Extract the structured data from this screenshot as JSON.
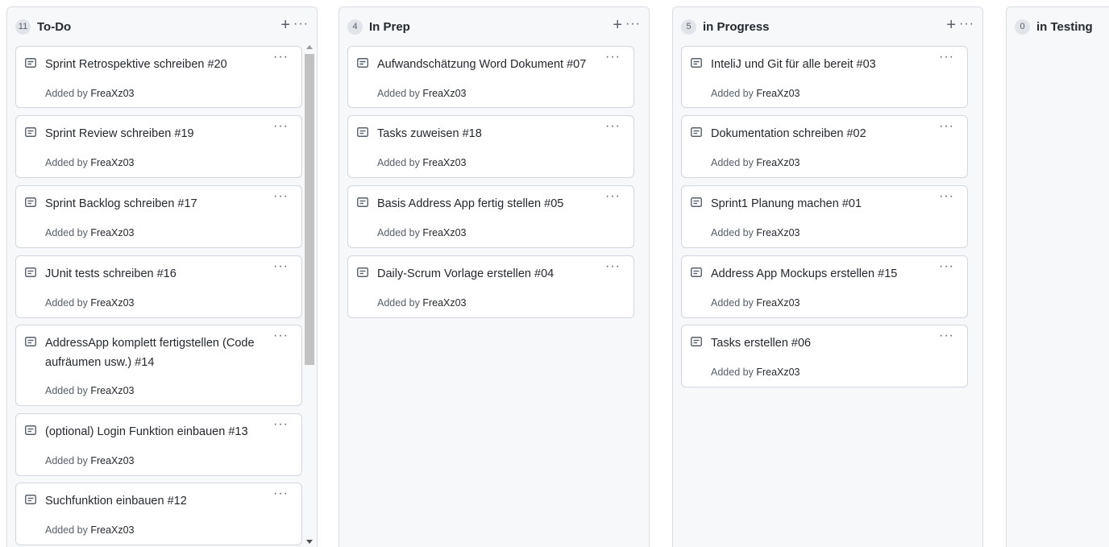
{
  "columns": [
    {
      "count": "11",
      "title": "To-Do",
      "add_label": "+",
      "menu_label": "···",
      "cards": [
        {
          "title": "Sprint Retrospektive schreiben #20",
          "added_by": "Added by",
          "author": "FreaXz03"
        },
        {
          "title": "Sprint Review schreiben #19",
          "added_by": "Added by",
          "author": "FreaXz03"
        },
        {
          "title": "Sprint Backlog schreiben #17",
          "added_by": "Added by",
          "author": "FreaXz03"
        },
        {
          "title": "JUnit tests schreiben #16",
          "added_by": "Added by",
          "author": "FreaXz03"
        },
        {
          "title": "AddressApp komplett fertigstellen (Code aufräumen usw.) #14",
          "added_by": "Added by",
          "author": "FreaXz03"
        },
        {
          "title": "(optional) Login Funktion einbauen #13",
          "added_by": "Added by",
          "author": "FreaXz03"
        },
        {
          "title": "Suchfunktion einbauen #12",
          "added_by": "Added by",
          "author": "FreaXz03"
        }
      ]
    },
    {
      "count": "4",
      "title": "In Prep",
      "add_label": "+",
      "menu_label": "···",
      "cards": [
        {
          "title": "Aufwandschätzung Word Dokument #07",
          "added_by": "Added by",
          "author": "FreaXz03"
        },
        {
          "title": "Tasks zuweisen #18",
          "added_by": "Added by",
          "author": "FreaXz03"
        },
        {
          "title": "Basis Address App fertig stellen #05",
          "added_by": "Added by",
          "author": "FreaXz03"
        },
        {
          "title": "Daily-Scrum Vorlage erstellen #04",
          "added_by": "Added by",
          "author": "FreaXz03"
        }
      ]
    },
    {
      "count": "5",
      "title": "in Progress",
      "add_label": "+",
      "menu_label": "···",
      "cards": [
        {
          "title": "InteliJ und Git für alle bereit #03",
          "added_by": "Added by",
          "author": "FreaXz03"
        },
        {
          "title": "Dokumentation schreiben #02",
          "added_by": "Added by",
          "author": "FreaXz03"
        },
        {
          "title": "Sprint1 Planung machen #01",
          "added_by": "Added by",
          "author": "FreaXz03"
        },
        {
          "title": "Address App Mockups erstellen #15",
          "added_by": "Added by",
          "author": "FreaXz03"
        },
        {
          "title": "Tasks erstellen #06",
          "added_by": "Added by",
          "author": "FreaXz03"
        }
      ]
    },
    {
      "count": "0",
      "title": "in Testing",
      "cards": []
    }
  ],
  "card_menu_label": "···",
  "icons": {
    "card": "note-icon",
    "add": "plus-icon",
    "menu": "kebab-icon"
  }
}
